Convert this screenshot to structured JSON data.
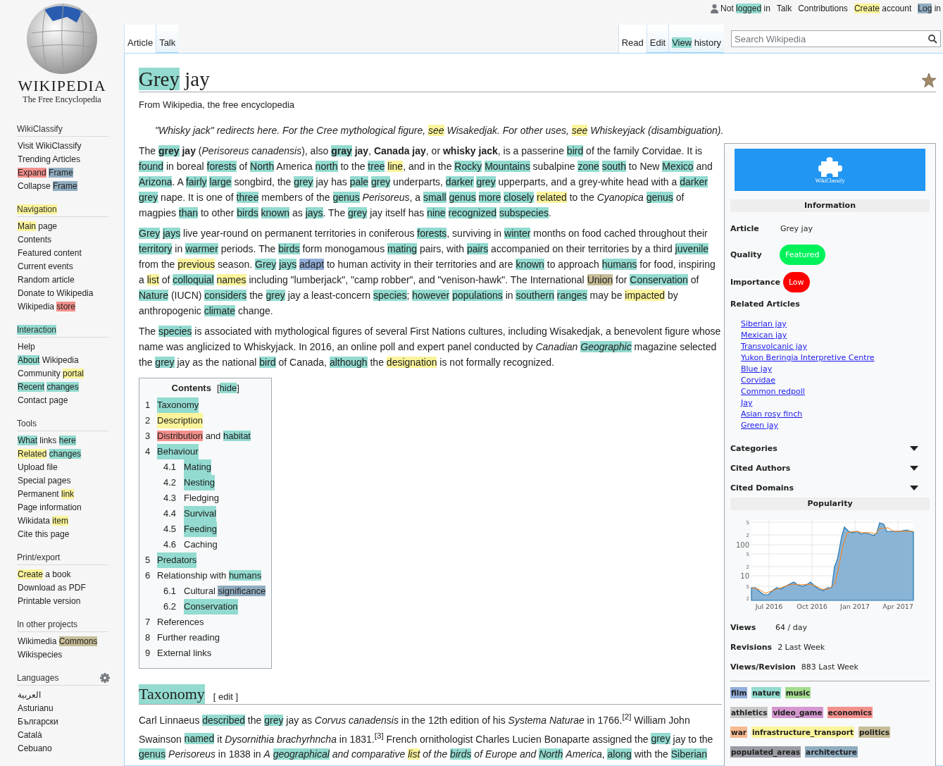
{
  "personal_links": [
    [
      "Not ",
      {
        "text": "logged",
        "color": "#93dbd0"
      },
      " in"
    ],
    [
      "Talk"
    ],
    [
      "Contributions"
    ],
    [
      {
        "text": "Create",
        "color": "#fbf49b"
      },
      " account"
    ],
    [
      {
        "text": "Log",
        "color": "#90adc0"
      },
      " in"
    ]
  ],
  "tabs_left": [
    {
      "segments": [
        "Article"
      ],
      "selected": true
    },
    {
      "segments": [
        "Talk"
      ],
      "selected": false
    }
  ],
  "tabs_right": [
    {
      "segments": [
        "Read"
      ],
      "selected": true
    },
    {
      "segments": [
        "Edit"
      ],
      "selected": false
    },
    {
      "segments": [
        {
          "text": "View",
          "color": "#93dbd0"
        },
        " history"
      ],
      "selected": false
    }
  ],
  "search": {
    "placeholder": "Search Wikipedia"
  },
  "logo": {
    "wordmark": "WIKIPEDIA",
    "tagline": "The Free Encyclopedia"
  },
  "sidebar": [
    {
      "heading": [
        "WikiClassify"
      ],
      "settings": false,
      "items": [
        [
          "Visit WikiClassify"
        ],
        [
          "Trending Articles"
        ],
        [
          {
            "text": "Expand",
            "color": "#f4908c"
          },
          {
            "text": "Frame",
            "color": "#90adc0"
          }
        ],
        [
          "Collapse ",
          {
            "text": "Frame",
            "color": "#90adc0"
          }
        ]
      ]
    },
    {
      "heading": [
        {
          "text": "Navigation",
          "color": "#fbf49b"
        }
      ],
      "settings": false,
      "items": [
        [
          {
            "text": "Main",
            "color": "#fbf49b"
          },
          " page"
        ],
        [
          "Contents"
        ],
        [
          "Featured content"
        ],
        [
          "Current events"
        ],
        [
          "Random article"
        ],
        [
          "Donate to Wikipedia"
        ],
        [
          "Wikipedia ",
          {
            "text": "store",
            "color": "#f4908c"
          }
        ]
      ]
    },
    {
      "heading": [
        {
          "text": "Interaction",
          "color": "#93dbd0"
        }
      ],
      "settings": false,
      "items": [
        [
          "Help"
        ],
        [
          {
            "text": "About",
            "color": "#93dbd0"
          },
          " Wikipedia"
        ],
        [
          "Community ",
          {
            "text": "portal",
            "color": "#fbf49b"
          }
        ],
        [
          {
            "text": "Recent",
            "color": "#93dbd0"
          },
          {
            "text": "changes",
            "color": "#93dbd0"
          }
        ],
        [
          "Contact page"
        ]
      ]
    },
    {
      "heading": [
        "Tools"
      ],
      "settings": false,
      "items": [
        [
          {
            "text": "What",
            "color": "#93dbd0"
          },
          " links ",
          {
            "text": "here",
            "color": "#93dbd0"
          }
        ],
        [
          {
            "text": "Related",
            "color": "#fbf49b"
          },
          {
            "text": "changes",
            "color": "#93dbd0"
          }
        ],
        [
          "Upload file"
        ],
        [
          "Special pages"
        ],
        [
          "Permanent ",
          {
            "text": "link",
            "color": "#fbf49b"
          }
        ],
        [
          "Page information"
        ],
        [
          "Wikidata ",
          {
            "text": "item",
            "color": "#fbf49b"
          }
        ],
        [
          "Cite this page"
        ]
      ]
    },
    {
      "heading": [
        "Print/export"
      ],
      "settings": false,
      "items": [
        [
          {
            "text": "Create",
            "color": "#fbf49b"
          },
          " a book"
        ],
        [
          "Download as PDF"
        ],
        [
          "Printable version"
        ]
      ]
    },
    {
      "heading": [
        "In other projects"
      ],
      "settings": false,
      "items": [
        [
          "Wikimedia ",
          {
            "text": "Commons",
            "color": "#c7bd98"
          }
        ],
        [
          "Wikispecies"
        ]
      ]
    },
    {
      "heading": [
        "Languages"
      ],
      "settings": true,
      "items": [
        [
          "العربية"
        ],
        [
          "Asturianu"
        ],
        [
          "Български"
        ],
        [
          "Català"
        ],
        [
          "Cebuano"
        ]
      ]
    }
  ],
  "title": [
    {
      "text": "Grey",
      "color": "#93dbd0"
    },
    " jay"
  ],
  "subtitle": "From Wikipedia, the free encyclopedia",
  "hatnote": [
    "\"Whisky jack\" redirects here. For the Cree mythological figure, ",
    {
      "text": "see",
      "color": "#fbf49b"
    },
    " Wisakedjak. For other uses, ",
    {
      "text": "see",
      "color": "#fbf49b"
    },
    " Whiskeyjack (disambiguation)."
  ],
  "paragraphs": [
    [
      "The ",
      {
        "text": "**grey**",
        "color": "#93dbd0"
      },
      " **jay** (*Perisoreus canadensis*), also ",
      {
        "text": "**gray**",
        "color": "#93dbd0"
      },
      " **jay**, **Canada jay**, or **whisky jack**, is a passerine ",
      {
        "text": "bird",
        "color": "#93dbd0"
      },
      " of the family Corvidae. It is ",
      {
        "text": "found",
        "color": "#93dbd0"
      },
      " in boreal ",
      {
        "text": "forests",
        "color": "#93dbd0"
      },
      " of ",
      {
        "text": "North",
        "color": "#93dbd0"
      },
      " America ",
      {
        "text": "north",
        "color": "#93dbd0"
      },
      " to the ",
      {
        "text": "tree",
        "color": "#93dbd0"
      },
      {
        "text": "line",
        "color": "#fbf49b"
      },
      ", and in the ",
      {
        "text": "Rocky",
        "color": "#93dbd0"
      },
      {
        "text": "Mountains",
        "color": "#93dbd0"
      },
      " subalpine ",
      {
        "text": "zone",
        "color": "#93dbd0"
      },
      {
        "text": "south",
        "color": "#93dbd0"
      },
      " to New ",
      {
        "text": "Mexico",
        "color": "#93dbd0"
      },
      " and ",
      {
        "text": "Arizona",
        "color": "#93dbd0"
      },
      ". A ",
      {
        "text": "fairly",
        "color": "#93dbd0"
      },
      {
        "text": "large",
        "color": "#93dbd0"
      },
      " songbird, the ",
      {
        "text": "grey",
        "color": "#93dbd0"
      },
      " jay has ",
      {
        "text": "pale",
        "color": "#93dbd0"
      },
      {
        "text": "grey",
        "color": "#93dbd0"
      },
      " underparts, ",
      {
        "text": "darker",
        "color": "#93dbd0"
      },
      {
        "text": "grey",
        "color": "#93dbd0"
      },
      " upperparts, and a grey-white head with a ",
      {
        "text": "darker",
        "color": "#93dbd0"
      },
      {
        "text": "grey",
        "color": "#93dbd0"
      },
      " nape. It is one of ",
      {
        "text": "three",
        "color": "#93dbd0"
      },
      " members of the ",
      {
        "text": "genus",
        "color": "#93dbd0"
      },
      " *Perisoreus*, a ",
      {
        "text": "small",
        "color": "#93dbd0"
      },
      {
        "text": "genus",
        "color": "#93dbd0"
      },
      {
        "text": "more",
        "color": "#93dbd0"
      },
      {
        "text": "closely",
        "color": "#93dbd0"
      },
      {
        "text": "related",
        "color": "#fbf49b"
      },
      " to the *Cyanopica* ",
      {
        "text": "genus",
        "color": "#93dbd0"
      },
      " of magpies ",
      {
        "text": "than",
        "color": "#93dbd0"
      },
      " to other ",
      {
        "text": "birds",
        "color": "#93dbd0"
      },
      {
        "text": "known",
        "color": "#93dbd0"
      },
      " as ",
      {
        "text": "jays",
        "color": "#93dbd0"
      },
      ". The ",
      {
        "text": "grey",
        "color": "#93dbd0"
      },
      " jay itself has ",
      {
        "text": "nine",
        "color": "#93dbd0"
      },
      {
        "text": "recognized",
        "color": "#93dbd0"
      },
      {
        "text": "subspecies",
        "color": "#93dbd0"
      },
      "."
    ],
    [
      {
        "text": "Grey",
        "color": "#93dbd0"
      },
      {
        "text": "jays",
        "color": "#93dbd0"
      },
      " live year-round on permanent territories in coniferous ",
      {
        "text": "forests",
        "color": "#93dbd0"
      },
      ", surviving in ",
      {
        "text": "winter",
        "color": "#93dbd0"
      },
      " months on food cached throughout their ",
      {
        "text": "territory",
        "color": "#93dbd0"
      },
      " in ",
      {
        "text": "warmer",
        "color": "#93dbd0"
      },
      " periods. The ",
      {
        "text": "birds",
        "color": "#93dbd0"
      },
      " form monogamous ",
      {
        "text": "mating",
        "color": "#93dbd0"
      },
      " pairs, with ",
      {
        "text": "pairs",
        "color": "#93dbd0"
      },
      " accompanied on their territories by a third ",
      {
        "text": "juvenile",
        "color": "#93dbd0"
      },
      " from the ",
      {
        "text": "previous",
        "color": "#fbf49b"
      },
      " season. ",
      {
        "text": "Grey",
        "color": "#93dbd0"
      },
      {
        "text": "jays",
        "color": "#93dbd0"
      },
      {
        "text": "adapt",
        "color": "#93aedb"
      },
      " to human activity in their territories and are ",
      {
        "text": "known",
        "color": "#93dbd0"
      },
      " to approach ",
      {
        "text": "humans",
        "color": "#93dbd0"
      },
      " for food, inspiring a ",
      {
        "text": "list",
        "color": "#fbf49b"
      },
      " of ",
      {
        "text": "colloquial",
        "color": "#93dbd0"
      },
      {
        "text": "names",
        "color": "#fbf49b"
      },
      " including \"lumberjack\", \"camp robber\", and \"venison-hawk\". The International ",
      {
        "text": "Union",
        "color": "#c7bd98"
      },
      " for ",
      {
        "text": "Conservation",
        "color": "#93dbd0"
      },
      " of ",
      {
        "text": "Nature",
        "color": "#93dbd0"
      },
      " (IUCN) ",
      {
        "text": "considers",
        "color": "#93dbd0"
      },
      " the ",
      {
        "text": "grey",
        "color": "#93dbd0"
      },
      " jay a least-concern ",
      {
        "text": "species",
        "color": "#93dbd0"
      },
      "; ",
      {
        "text": "however",
        "color": "#93dbd0"
      },
      {
        "text": "populations",
        "color": "#93dbd0"
      },
      " in ",
      {
        "text": "southern",
        "color": "#93dbd0"
      },
      {
        "text": "ranges",
        "color": "#93dbd0"
      },
      " may be ",
      {
        "text": "impacted",
        "color": "#fbf49b"
      },
      " by anthropogenic ",
      {
        "text": "climate",
        "color": "#93dbd0"
      },
      " change."
    ],
    [
      "The ",
      {
        "text": "species",
        "color": "#93dbd0"
      },
      " is associated with mythological figures of several First Nations cultures, including Wisakedjak, a benevolent figure whose name was anglicized to Whiskyjack. In 2016, an online poll and expert panel conducted by *Canadian* ",
      {
        "text": "*Geographic*",
        "color": "#93dbd0"
      },
      " magazine selected the ",
      {
        "text": "grey",
        "color": "#93dbd0"
      },
      " jay as the national ",
      {
        "text": "bird",
        "color": "#93dbd0"
      },
      " of Canada, ",
      {
        "text": "although",
        "color": "#93dbd0"
      },
      " the ",
      {
        "text": "designation",
        "color": "#fbf49b"
      },
      " is not formally recognized."
    ]
  ],
  "toc": {
    "title": "Contents",
    "toggle": [
      "[",
      {
        "text": "hide",
        "color": "#93dbd0"
      },
      "]"
    ],
    "items": [
      {
        "number": "1",
        "segments": [
          {
            "text": "Taxonomy",
            "color": "#93dbd0"
          }
        ]
      },
      {
        "number": "2",
        "segments": [
          {
            "text": "Description",
            "color": "#fbf49b"
          }
        ]
      },
      {
        "number": "3",
        "segments": [
          {
            "text": "Distribution",
            "color": "#f4908c"
          },
          " and ",
          {
            "text": "habitat",
            "color": "#93dbd0"
          }
        ]
      },
      {
        "number": "4",
        "segments": [
          {
            "text": "Behaviour",
            "color": "#93dbd0"
          }
        ],
        "children": [
          {
            "number": "4.1",
            "segments": [
              {
                "text": "Mating",
                "color": "#93dbd0"
              }
            ]
          },
          {
            "number": "4.2",
            "segments": [
              {
                "text": "Nesting",
                "color": "#93dbd0"
              }
            ]
          },
          {
            "number": "4.3",
            "segments": [
              "Fledging"
            ]
          },
          {
            "number": "4.4",
            "segments": [
              {
                "text": "Survival",
                "color": "#93dbd0"
              }
            ]
          },
          {
            "number": "4.5",
            "segments": [
              {
                "text": "Feeding",
                "color": "#93dbd0"
              }
            ]
          },
          {
            "number": "4.6",
            "segments": [
              "Caching"
            ]
          }
        ]
      },
      {
        "number": "5",
        "segments": [
          {
            "text": "Predators",
            "color": "#93dbd0"
          }
        ]
      },
      {
        "number": "6",
        "segments": [
          "Relationship with ",
          {
            "text": "humans",
            "color": "#93dbd0"
          }
        ],
        "children": [
          {
            "number": "6.1",
            "segments": [
              "Cultural ",
              {
                "text": "significance",
                "color": "#90adc0"
              }
            ]
          },
          {
            "number": "6.2",
            "segments": [
              {
                "text": "Conservation",
                "color": "#93dbd0"
              }
            ]
          }
        ]
      },
      {
        "number": "7",
        "segments": [
          "References"
        ]
      },
      {
        "number": "8",
        "segments": [
          "Further reading"
        ]
      },
      {
        "number": "9",
        "segments": [
          "External links"
        ]
      }
    ]
  },
  "sections": [
    {
      "heading": [
        {
          "text": "Taxonomy",
          "color": "#93dbd0"
        }
      ],
      "edit": "[ edit ]",
      "paragraphs": [
        [
          "Carl Linnaeus ",
          {
            "text": "described",
            "color": "#93dbd0"
          },
          " the ",
          {
            "text": "grey",
            "color": "#93dbd0"
          },
          " jay as *Corvus canadensis* in the 12th edition of his *Systema Naturae* in 1766.$^{[2]}$ William John Swainson ",
          {
            "text": "named",
            "color": "#93dbd0"
          },
          " it *Dysornithia brachyrhncha* in 1831.$^{[3]}$ French ornithologist Charles Lucien Bonaparte assigned the ",
          {
            "text": "grey",
            "color": "#93dbd0"
          },
          " jay to the ",
          {
            "text": "genus",
            "color": "#93dbd0"
          },
          " *Perisoreus* in 1838 in *A* ",
          {
            "text": "*geographical*",
            "color": "#93dbd0"
          },
          " *and comparative* ",
          {
            "text": "*list*",
            "color": "#fbf49b"
          },
          " *of the* ",
          {
            "text": "*birds*",
            "color": "#93dbd0"
          },
          " *of Europe and* ",
          {
            "text": "*North*",
            "color": "#93dbd0"
          },
          " *America*, ",
          {
            "text": "along",
            "color": "#93dbd0"
          },
          " with the ",
          {
            "text": "Siberian",
            "color": "#93dbd0"
          }
        ]
      ]
    }
  ],
  "panel": {
    "brand": "WikiClassify",
    "info_title": "Information",
    "article": {
      "label": "Article",
      "value": "Grey jay"
    },
    "quality": {
      "label": "Quality",
      "value": "Featured",
      "color": "#00f25a"
    },
    "importance": {
      "label": "Importance",
      "value": "Low",
      "color": "#ff0000"
    },
    "related_title": "Related Articles",
    "related": [
      "Siberian jay",
      "Mexican jay",
      "Transvolcanic jay",
      "Yukon Beringia Interpretive Centre",
      "Blue jay",
      "Corvidae",
      "Common redpoll",
      "Jay",
      "Asian rosy finch",
      "Green jay"
    ],
    "collapsibles": [
      {
        "label": "Categories",
        "expanded": false
      },
      {
        "label": "Cited Authors",
        "expanded": false
      },
      {
        "label": "Cited Domains",
        "expanded": false
      }
    ],
    "popularity_title": "Popularity",
    "popularity_chart": {
      "y_labels": [
        "5",
        "2",
        "100",
        "5",
        "2",
        "10",
        "5",
        "2"
      ],
      "x_labels": [
        "Jul 2016",
        "Oct 2016",
        "Jan 2017",
        "Apr 2017"
      ]
    },
    "stats": [
      {
        "label": "Views",
        "value": "64 / day"
      },
      {
        "label": "Revisions",
        "value": "2 Last Week"
      },
      {
        "label": "Views/Revision",
        "value": "883 Last Week"
      }
    ],
    "tag_rows": [
      [
        {
          "label": "film",
          "color": "#93aedb"
        },
        {
          "label": "nature",
          "color": "#93dbd0"
        },
        {
          "label": "music",
          "color": "#a4dc8e"
        }
      ],
      [
        {
          "label": "athletics",
          "color": "#c9c9c9"
        },
        {
          "label": "video_game",
          "color": "#d497cf"
        },
        {
          "label": "economics",
          "color": "#f4908c"
        }
      ],
      [
        {
          "label": "war",
          "color": "#f7b990"
        },
        {
          "label": "infrastructure_transport",
          "color": "#fbf49b"
        },
        {
          "label": "politics",
          "color": "#c7bd98"
        }
      ],
      [
        {
          "label": "populated_areas",
          "color": "#9b9ba3"
        },
        {
          "label": "architecture",
          "color": "#90adc0"
        }
      ]
    ]
  }
}
